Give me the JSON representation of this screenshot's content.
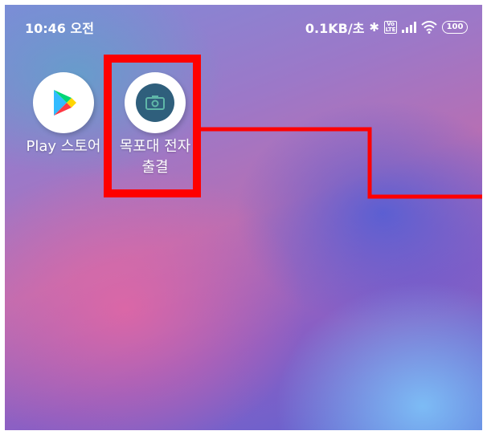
{
  "status_bar": {
    "time": "10:46 오전",
    "network_speed": "0.1KB/초",
    "volte_label": "Vo LTE",
    "battery_level": "100"
  },
  "apps": [
    {
      "label": "Play 스토어",
      "icon": "play-store-icon"
    },
    {
      "label": "목포대 전자출결",
      "icon": "attendance-app-icon"
    }
  ],
  "annotation": {
    "color": "#ff0000"
  },
  "colors": {
    "status_text": "#ffffff",
    "attendance_icon_inner": "#2f5f7c"
  }
}
